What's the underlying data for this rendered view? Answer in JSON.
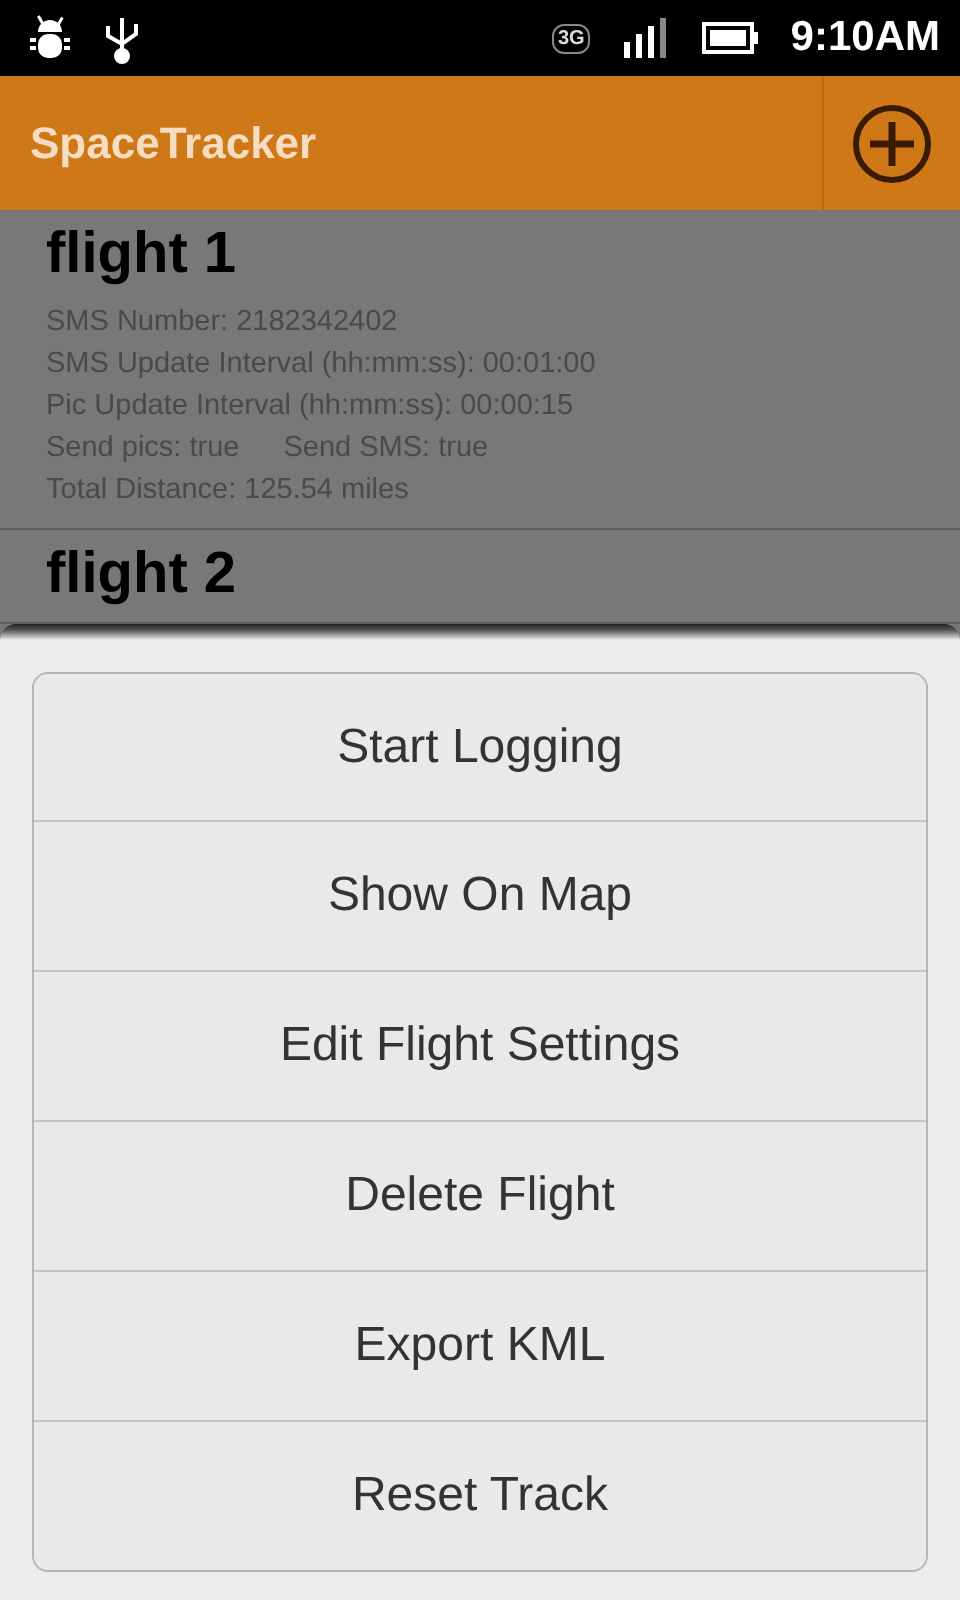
{
  "status_bar": {
    "time": "9:10AM",
    "network": "3G"
  },
  "app_bar": {
    "title": "SpaceTracker"
  },
  "flights": [
    {
      "name": "flight 1",
      "details": [
        "SMS Number:  2182342402",
        "SMS Update Interval (hh:mm:ss):  00:01:00",
        "Pic Update Interval (hh:mm:ss):  00:00:15"
      ],
      "send_pics": "Send pics:  true",
      "send_sms": "Send SMS:  true",
      "distance": "Total Distance:  125.54 miles"
    },
    {
      "name": "flight 2"
    }
  ],
  "menu": {
    "items": [
      "Start Logging",
      "Show On Map",
      "Edit Flight Settings",
      "Delete Flight",
      "Export KML",
      "Reset Track"
    ]
  }
}
